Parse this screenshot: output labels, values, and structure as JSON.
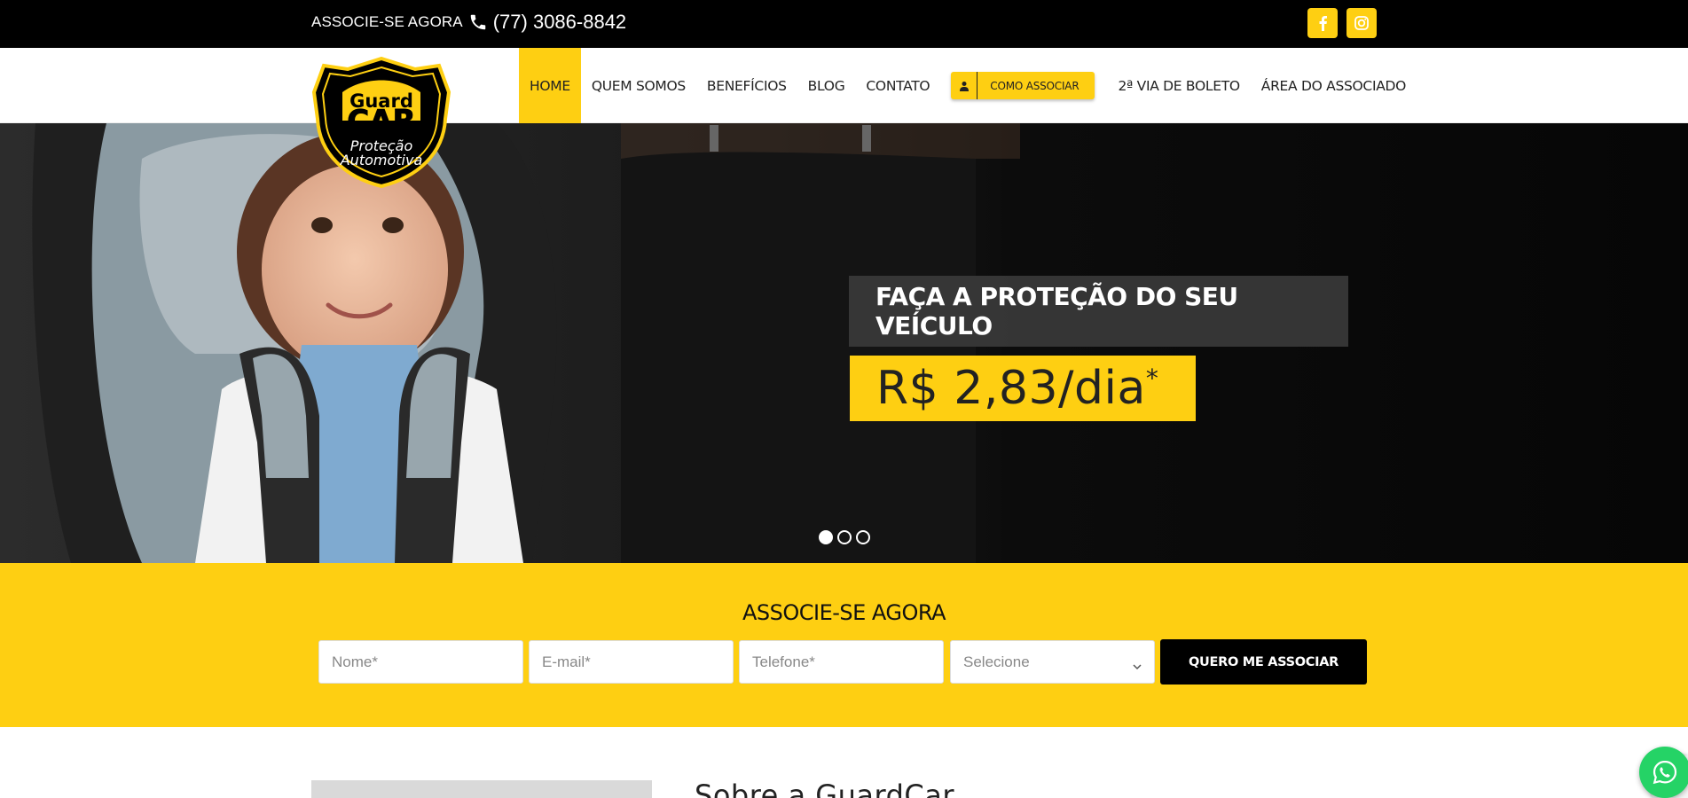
{
  "topbar": {
    "cta": "ASSOCIE-SE AGORA",
    "phone": "(77) 3086-8842",
    "social": [
      "facebook-icon",
      "instagram-icon"
    ]
  },
  "logo": {
    "line1": "Guard",
    "line2": "CAR",
    "line3": "Proteção",
    "line4": "Automotiva"
  },
  "nav": {
    "items": [
      "HOME",
      "QUEM SOMOS",
      "BENEFÍCIOS",
      "BLOG",
      "CONTATO"
    ],
    "cta": "COMO ASSOCIAR",
    "extra": [
      "2ª VIA DE BOLETO",
      "ÁREA DO ASSOCIADO"
    ],
    "active": "HOME"
  },
  "hero": {
    "headline": "FAÇA A PROTEÇÃO DO SEU VEÍCULO",
    "price": "R$ 2,83/dia",
    "price_mark": "*",
    "slides": 3,
    "active_slide": 1
  },
  "form": {
    "title": "ASSOCIE-SE AGORA",
    "name_placeholder": "Nome*",
    "email_placeholder": "E-mail*",
    "phone_placeholder": "Telefone*",
    "select_value": "Selecione",
    "submit": "QUERO ME ASSOCIAR"
  },
  "about": {
    "title": "Sobre a GuardCar"
  },
  "colors": {
    "brand_yellow": "#fecf12",
    "black": "#000000",
    "whatsapp": "#25d366"
  }
}
